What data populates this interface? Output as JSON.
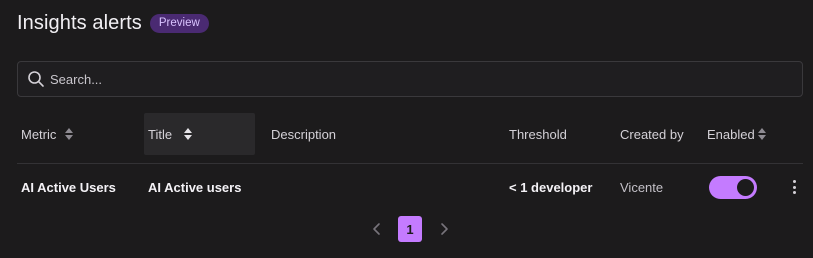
{
  "header": {
    "title": "Insights alerts",
    "badge": "Preview"
  },
  "search": {
    "placeholder": "Search...",
    "value": ""
  },
  "table": {
    "columns": [
      {
        "label": "Metric",
        "sortable": true
      },
      {
        "label": "Title",
        "sortable": true
      },
      {
        "label": "Description",
        "sortable": false
      },
      {
        "label": "Threshold",
        "sortable": false
      },
      {
        "label": "Created by",
        "sortable": false
      },
      {
        "label": "Enabled",
        "sortable": true
      }
    ],
    "rows": [
      {
        "metric": "AI Active Users",
        "title": "AI Active users",
        "description": "",
        "threshold": "< 1 developer",
        "created_by": "Vicente",
        "enabled": true
      }
    ]
  },
  "pagination": {
    "current_page": "1"
  },
  "colors": {
    "background": "#1c1b1c",
    "accent": "#c47bff",
    "badge_bg": "#4a2a72",
    "badge_text": "#d9c3ff"
  }
}
